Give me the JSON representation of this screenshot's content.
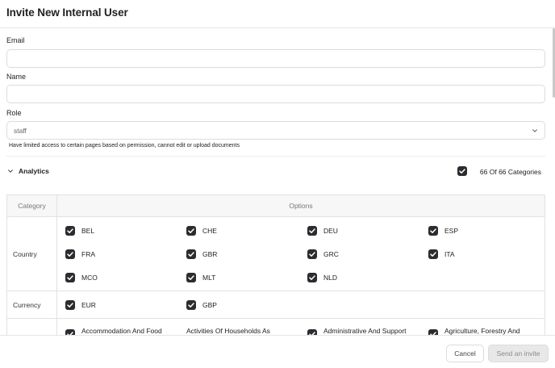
{
  "dialog": {
    "title": "Invite New Internal User"
  },
  "form": {
    "email_label": "Email",
    "email_value": "",
    "name_label": "Name",
    "name_value": "",
    "role_label": "Role",
    "role_value": "staff",
    "role_help": "Have limited access to certain pages based on permission, cannot edit or upload documents"
  },
  "section": {
    "title": "Analytics",
    "count_text": "66 Of 66 Categories",
    "all_checked": true
  },
  "table": {
    "headers": [
      "Category",
      "Options"
    ],
    "rows": [
      {
        "category": "Country",
        "options": [
          "BEL",
          "CHE",
          "DEU",
          "ESP",
          "FRA",
          "GBR",
          "GRC",
          "ITA",
          "MCO",
          "MLT",
          "NLD"
        ]
      },
      {
        "category": "Currency",
        "options": [
          "EUR",
          "GBP"
        ]
      },
      {
        "category": "",
        "options": [
          "Accommodation And Food",
          "Activities Of Households As",
          "Administrative And Support",
          "Agriculture, Forestry And"
        ]
      }
    ]
  },
  "footer": {
    "cancel_label": "Cancel",
    "send_label": "Send an invite"
  },
  "colors": {
    "checkbox": "#2b2b30",
    "border": "#e2e2e2",
    "disabled_button": "#e8e8e8"
  }
}
